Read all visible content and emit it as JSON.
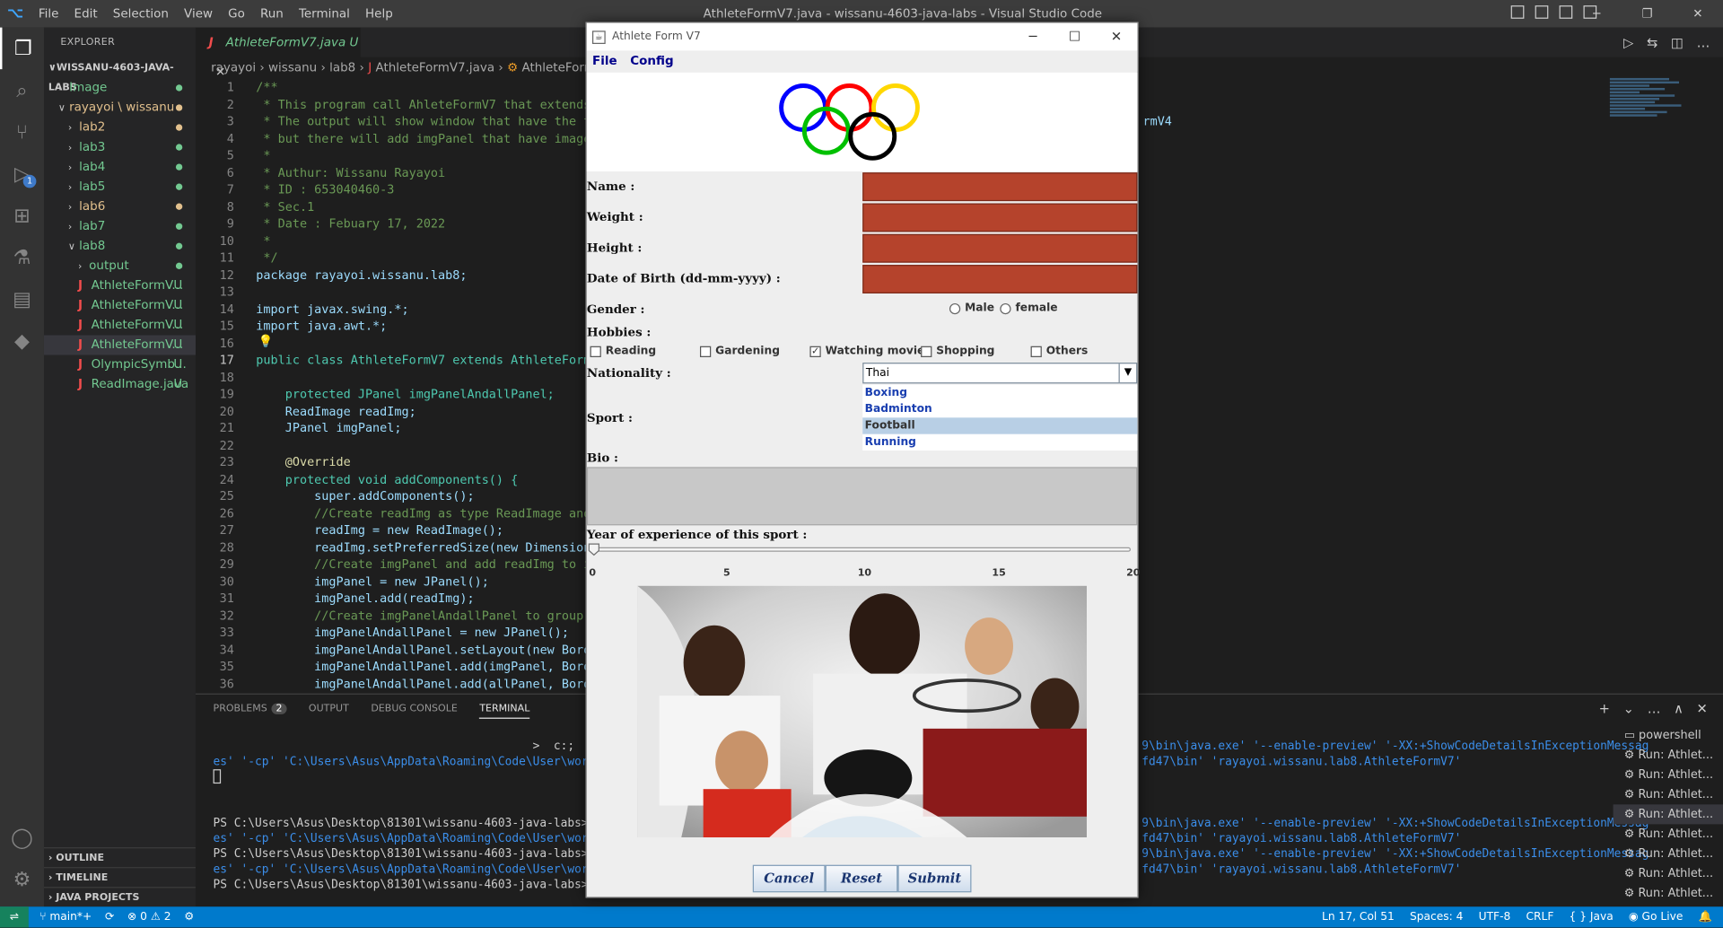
{
  "window": {
    "title": "AthleteFormV7.java - wissanu-4603-java-labs - Visual Studio Code",
    "menu": [
      "File",
      "Edit",
      "Selection",
      "View",
      "Go",
      "Run",
      "Terminal",
      "Help"
    ]
  },
  "sidebar": {
    "header": "EXPLORER",
    "root": "WISSANU-4603-JAVA-LABS",
    "items": [
      {
        "label": "Image",
        "indent": 1
      },
      {
        "label": "rayayoi \\ wissanu",
        "indent": 1
      },
      {
        "label": "lab2",
        "indent": 2
      },
      {
        "label": "lab3",
        "indent": 2
      },
      {
        "label": "lab4",
        "indent": 2
      },
      {
        "label": "lab5",
        "indent": 2
      },
      {
        "label": "lab6",
        "indent": 2
      },
      {
        "label": "lab7",
        "indent": 2
      },
      {
        "label": "lab8",
        "indent": 2
      },
      {
        "label": "output",
        "indent": 3
      },
      {
        "label": "AthleteFormV...",
        "indent": 3,
        "status": "U"
      },
      {
        "label": "AthleteFormV...",
        "indent": 3,
        "status": "U"
      },
      {
        "label": "AthleteFormV...",
        "indent": 3,
        "status": "U"
      },
      {
        "label": "AthleteFormV...",
        "indent": 3,
        "status": "U"
      },
      {
        "label": "OlympicSymb...",
        "indent": 3,
        "status": "U"
      },
      {
        "label": "ReadImage.java",
        "indent": 3,
        "status": "U"
      }
    ],
    "bottom": [
      "OUTLINE",
      "TIMELINE",
      "JAVA PROJECTS"
    ]
  },
  "editor": {
    "tab_label": "AthleteFormV7.java",
    "tab_status": "U",
    "breadcrumb": [
      "rayayoi",
      "wissanu",
      "lab8",
      "AthleteFormV7.java",
      "AthleteFormV7"
    ],
    "lines": [
      {
        "n": "1",
        "t": "/**"
      },
      {
        "n": "2",
        "t": " * This program call AhleteFormV7 that extends f"
      },
      {
        "n": "3",
        "t": " * The output will show window that have the tit"
      },
      {
        "n": "4",
        "t": " * but there will add imgPanel that have image t"
      },
      {
        "n": "5",
        "t": " *"
      },
      {
        "n": "6",
        "t": " * Authur: Wissanu Rayayoi"
      },
      {
        "n": "7",
        "t": " * ID : 653040460-3"
      },
      {
        "n": "8",
        "t": " * Sec.1"
      },
      {
        "n": "9",
        "t": " * Date : Febuary 17, 2022"
      },
      {
        "n": "10",
        "t": " *"
      },
      {
        "n": "11",
        "t": " */"
      },
      {
        "n": "12",
        "t": "package rayayoi.wissanu.lab8;"
      },
      {
        "n": "13",
        "t": ""
      },
      {
        "n": "14",
        "t": "import javax.swing.*;"
      },
      {
        "n": "15",
        "t": "import java.awt.*;"
      },
      {
        "n": "16",
        "t": ""
      },
      {
        "n": "17",
        "t": "public class AthleteFormV7 extends AthleteFormV6"
      },
      {
        "n": "18",
        "t": ""
      },
      {
        "n": "19",
        "t": "    protected JPanel imgPanelAndallPanel;"
      },
      {
        "n": "20",
        "t": "    ReadImage readImg;"
      },
      {
        "n": "21",
        "t": "    JPanel imgPanel;"
      },
      {
        "n": "22",
        "t": ""
      },
      {
        "n": "23",
        "t": "    @Override"
      },
      {
        "n": "24",
        "t": "    protected void addComponents() {"
      },
      {
        "n": "25",
        "t": "        super.addComponents();"
      },
      {
        "n": "26",
        "t": "        //Create readImg as type ReadImage and s"
      },
      {
        "n": "27",
        "t": "        readImg = new ReadImage();"
      },
      {
        "n": "28",
        "t": "        readImg.setPreferredSize(new Dimension(W"
      },
      {
        "n": "29",
        "t": "        //Create imgPanel and add readImg to img"
      },
      {
        "n": "30",
        "t": "        imgPanel = new JPanel();"
      },
      {
        "n": "31",
        "t": "        imgPanel.add(readImg);"
      },
      {
        "n": "32",
        "t": "        //Create imgPanelAndallPanel to group al"
      },
      {
        "n": "33",
        "t": "        imgPanelAndallPanel = new JPanel();"
      },
      {
        "n": "34",
        "t": "        imgPanelAndallPanel.setLayout(new Border"
      },
      {
        "n": "35",
        "t": "        imgPanelAndallPanel.add(imgPanel, Border"
      },
      {
        "n": "36",
        "t": "        imgPanelAndallPanel.add(allPanel, Border"
      }
    ],
    "overflow_text": "rmV4"
  },
  "panel": {
    "tabs": [
      "PROBLEMS",
      "OUTPUT",
      "DEBUG CONSOLE",
      "TERMINAL"
    ],
    "problems_count": "2",
    "terminal_lines": [
      {
        "a": "                                              >  c:;",
        "b": "9\\bin\\java.exe' '--enable-preview' '-XX:+ShowCodeDetailsInExceptionMessag"
      },
      {
        "a": "es' '-cp' 'C:\\Users\\Asus\\AppData\\Roaming\\Code\\User\\workspac",
        "b": "fd47\\bin' 'rayayoi.wissanu.lab8.AthleteFormV7'"
      },
      {
        "a": "",
        "b": ""
      },
      {
        "a": "",
        "b": ""
      },
      {
        "a": "",
        "b": ""
      },
      {
        "a": "PS C:\\Users\\Asus\\Desktop\\81301\\wissanu-4603-java-labs>  c:;",
        "b": "9\\bin\\java.exe' '--enable-preview' '-XX:+ShowCodeDetailsInExceptionMessag"
      },
      {
        "a": "es' '-cp' 'C:\\Users\\Asus\\AppData\\Roaming\\Code\\User\\workspac",
        "b": "fd47\\bin' 'rayayoi.wissanu.lab8.AthleteFormV7'"
      },
      {
        "a": "PS C:\\Users\\Asus\\Desktop\\81301\\wissanu-4603-java-labs>  c:;",
        "b": "9\\bin\\java.exe' '--enable-preview' '-XX:+ShowCodeDetailsInExceptionMessag"
      },
      {
        "a": "es' '-cp' 'C:\\Users\\Asus\\AppData\\Roaming\\Code\\User\\workspac",
        "b": "fd47\\bin' 'rayayoi.wissanu.lab8.AthleteFormV7'"
      },
      {
        "a": "PS C:\\Users\\Asus\\Desktop\\81301\\wissanu-4603-java-labs>",
        "b": ""
      }
    ],
    "terminals": [
      "powershell",
      "Run: Athlet...",
      "Run: Athlet...",
      "Run: Athlet...",
      "Run: Athlet...",
      "Run: Athlet...",
      "Run: Athlet...",
      "Run: Athlet...",
      "Run: Athlet..."
    ]
  },
  "status": {
    "branch": "main*+",
    "errors": "0",
    "warnings": "2",
    "position": "Ln 17, Col 51",
    "spaces": "Spaces: 4",
    "encoding": "UTF-8",
    "eol": "CRLF",
    "language": "Java",
    "golive": "Go Live"
  },
  "form": {
    "title": "Athlete Form V7",
    "menu": [
      "File",
      "Config"
    ],
    "labels": {
      "name": "Name :",
      "weight": "Weight :",
      "height": "Height :",
      "dob": "Date of Birth (dd-mm-yyyy) :",
      "gender": "Gender :",
      "hobbies": "Hobbies :",
      "nationality": "Nationality :",
      "sport": "Sport :",
      "bio": "Bio :",
      "experience": "Year of experience of this sport :"
    },
    "gender_options": [
      "Male",
      "female"
    ],
    "hobbies": [
      {
        "label": "Reading",
        "checked": false
      },
      {
        "label": "Gardening",
        "checked": false
      },
      {
        "label": "Watching movies",
        "checked": true
      },
      {
        "label": "Shopping",
        "checked": false
      },
      {
        "label": "Others",
        "checked": false
      }
    ],
    "nationality": "Thai",
    "sports": [
      "Boxing",
      "Badminton",
      "Football",
      "Running"
    ],
    "selected_sport": "Football",
    "slider": {
      "min": 0,
      "max": 20,
      "value": 0,
      "ticks": [
        "0",
        "5",
        "10",
        "15",
        "20"
      ]
    },
    "buttons": {
      "cancel": "Cancel",
      "reset": "Reset",
      "submit": "Submit"
    },
    "colors": {
      "textfield": "#b5432c",
      "ring_blue": "#0000ff",
      "ring_red": "#ff0000",
      "ring_yellow": "#ffd700",
      "ring_green": "#00c000",
      "ring_black": "#000000"
    }
  }
}
